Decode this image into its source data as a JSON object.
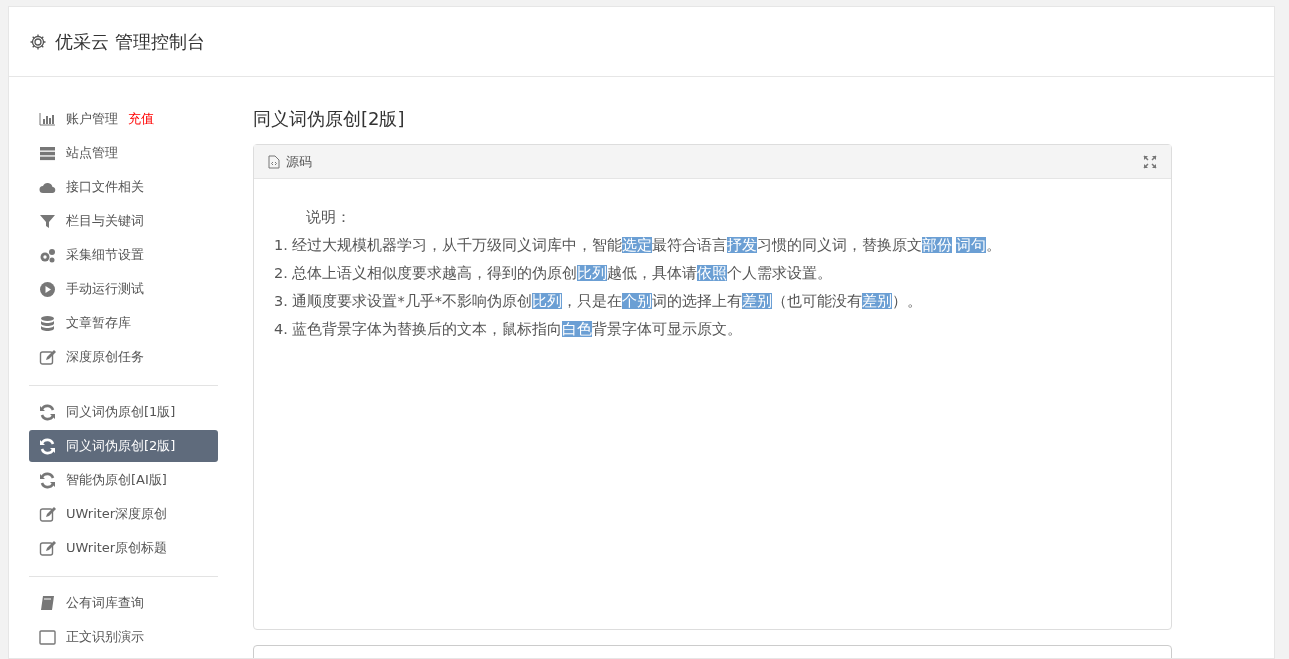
{
  "header": {
    "title": "优采云 管理控制台"
  },
  "sidebar": {
    "groups": [
      {
        "items": [
          {
            "kind": "chart",
            "label": "账户管理",
            "badge": "充值",
            "selected": false
          },
          {
            "kind": "server",
            "label": "站点管理",
            "selected": false
          },
          {
            "kind": "cloud",
            "label": "接口文件相关",
            "selected": false
          },
          {
            "kind": "filter",
            "label": "栏目与关键词",
            "selected": false
          },
          {
            "kind": "gears",
            "label": "采集细节设置",
            "selected": false
          },
          {
            "kind": "play",
            "label": "手动运行测试",
            "selected": false
          },
          {
            "kind": "database",
            "label": "文章暂存库",
            "selected": false
          },
          {
            "kind": "edit",
            "label": "深度原创任务",
            "selected": false
          }
        ]
      },
      {
        "items": [
          {
            "kind": "refresh",
            "label": "同义词伪原创[1版]",
            "selected": false
          },
          {
            "kind": "refresh",
            "label": "同义词伪原创[2版]",
            "selected": true
          },
          {
            "kind": "refresh",
            "label": "智能伪原创[AI版]",
            "selected": false
          },
          {
            "kind": "edit",
            "label": "UWriter深度原创",
            "selected": false
          },
          {
            "kind": "edit",
            "label": "UWriter原创标题",
            "selected": false
          }
        ]
      },
      {
        "items": [
          {
            "kind": "book",
            "label": "公有词库查询",
            "selected": false
          },
          {
            "kind": "window",
            "label": "正文识别演示",
            "selected": false
          }
        ]
      }
    ]
  },
  "page_title": "同义词伪原创[2版]",
  "editor": {
    "tab": "源码",
    "heading": "说明：",
    "lines": [
      [
        {
          "text": "1. 经过大规模机器学习，从千万级同义词库中，智能",
          "replaced": false
        },
        {
          "text": "选定",
          "replaced": true
        },
        {
          "text": "最符合语言",
          "replaced": false
        },
        {
          "text": "抒发",
          "replaced": true
        },
        {
          "text": "习惯的同义词，替换原文",
          "replaced": false
        },
        {
          "text": "部份",
          "replaced": true
        },
        {
          "text": "词句",
          "replaced": true
        },
        {
          "text": "。",
          "replaced": false
        }
      ],
      [
        {
          "text": "2. 总体上语义相似度要求越高，得到的伪原创",
          "replaced": false
        },
        {
          "text": "比列",
          "replaced": true
        },
        {
          "text": "越低，具体请",
          "replaced": false
        },
        {
          "text": "依照",
          "replaced": true
        },
        {
          "text": "个人需求设置。",
          "replaced": false
        }
      ],
      [
        {
          "text": "3. 通顺度要求设置*几乎*不影响伪原创",
          "replaced": false
        },
        {
          "text": "比列",
          "replaced": true
        },
        {
          "text": "，只是在",
          "replaced": false
        },
        {
          "text": "个别",
          "replaced": true
        },
        {
          "text": "词的选择上有",
          "replaced": false
        },
        {
          "text": "差别",
          "replaced": true
        },
        {
          "text": "（也可能没有",
          "replaced": false
        },
        {
          "text": "差别",
          "replaced": true
        },
        {
          "text": "）。",
          "replaced": false
        }
      ],
      [
        {
          "text": "4. 蓝色背景字体为替换后的文本，鼠标指向",
          "replaced": false
        },
        {
          "text": "白色",
          "replaced": true
        },
        {
          "text": "背景字体可显示原文。",
          "replaced": false
        }
      ]
    ]
  }
}
